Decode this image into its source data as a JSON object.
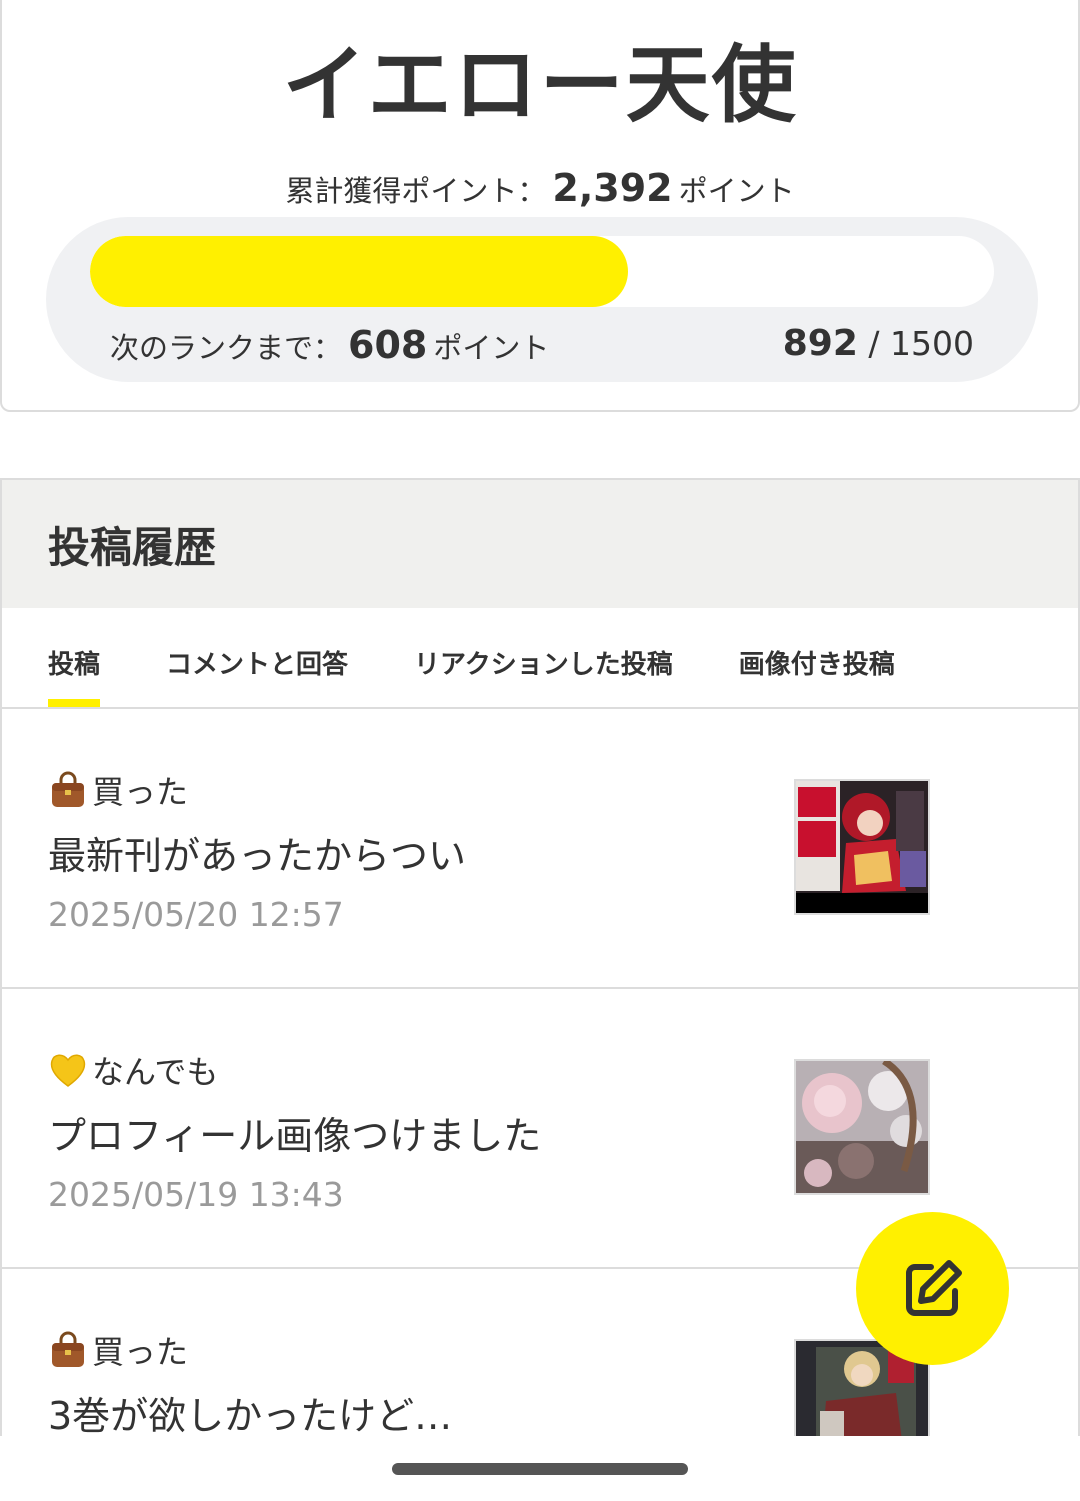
{
  "rank": {
    "title": "イエロー天使",
    "total_label": "累計獲得ポイント：",
    "total_value": "2,392",
    "total_unit": "ポイント",
    "next_label": "次のランクまで：",
    "next_value": "608",
    "next_unit": "ポイント",
    "current": "892",
    "separator": " / ",
    "target": "1500",
    "progress_fraction": 0.595,
    "accent_color": "#fff000"
  },
  "history": {
    "heading": "投稿履歴",
    "tabs": [
      {
        "label": "投稿",
        "active": true
      },
      {
        "label": "コメントと回答",
        "active": false
      },
      {
        "label": "リアクションした投稿",
        "active": false
      },
      {
        "label": "画像付き投稿",
        "active": false
      }
    ],
    "posts": [
      {
        "category_icon": "handbag-icon",
        "category": "買った",
        "title": "最新刊があったからつい",
        "date": "2025/05/20 12:57"
      },
      {
        "category_icon": "yellow-heart-icon",
        "category": "なんでも",
        "title": "プロフィール画像つけました",
        "date": "2025/05/19 13:43"
      },
      {
        "category_icon": "handbag-icon",
        "category": "買った",
        "title": "3巻が欲しかったけど…",
        "date": ""
      }
    ]
  },
  "fab": {
    "icon": "edit-icon"
  }
}
